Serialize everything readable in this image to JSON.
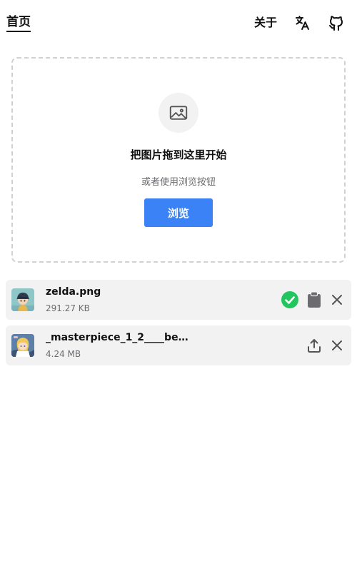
{
  "nav": {
    "home": "首页",
    "about": "关于",
    "translate_icon": "translate-icon",
    "github_icon": "github-icon"
  },
  "dropzone": {
    "icon": "image-icon",
    "title": "把图片拖到这里开始",
    "subtitle": "或者使用浏览按钮",
    "browse_label": "浏览",
    "accent": "#3b82f6"
  },
  "files": [
    {
      "name": "zelda.png",
      "size": "291.27 KB",
      "status": "done",
      "actions": [
        "check-icon",
        "clipboard-icon",
        "close-icon"
      ],
      "status_color": "#22c55e"
    },
    {
      "name": "_masterpiece_1_2____be...",
      "size": "4.24 MB",
      "status": "pending",
      "actions": [
        "upload-icon",
        "close-icon"
      ]
    }
  ]
}
